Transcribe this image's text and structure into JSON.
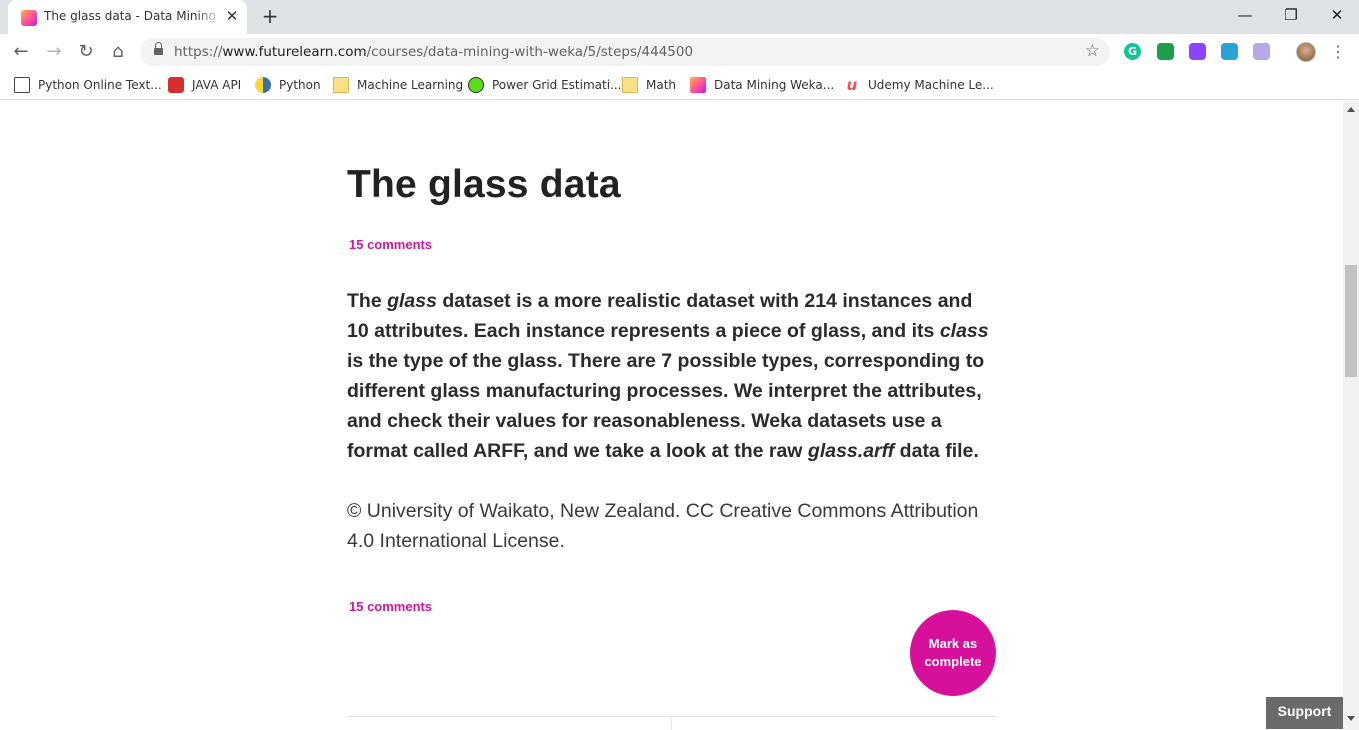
{
  "browser": {
    "tab": {
      "title": "The glass data - Data Mining with Weka",
      "close": "✕"
    },
    "new_tab": "+",
    "window": {
      "minimize": "—",
      "restore": "❐",
      "close": "✕"
    },
    "url": {
      "scheme": "https://",
      "host": "www.futurelearn.com",
      "path": "/courses/data-mining-with-weka/5/steps/444500"
    },
    "extensions": [
      "grammarly-icon",
      "cast-icon",
      "puzzle-icon",
      "cloud-icon",
      "puzzle-icon"
    ],
    "bookmarks": [
      {
        "label": "Python Online Text...",
        "icon": "page-icon"
      },
      {
        "label": "JAVA API",
        "icon": "java-icon"
      },
      {
        "label": "Python",
        "icon": "python-icon"
      },
      {
        "label": "Machine Learning",
        "icon": "folder-icon"
      },
      {
        "label": "Power Grid Estimati...",
        "icon": "smiley-icon"
      },
      {
        "label": "Math",
        "icon": "folder-icon"
      },
      {
        "label": "Data Mining Weka...",
        "icon": "futurelearn-icon"
      },
      {
        "label": "Udemy Machine Le...",
        "icon": "udemy-icon"
      }
    ]
  },
  "article": {
    "title": "The glass data",
    "comments_top": "15 comments",
    "summary": {
      "p1": "The ",
      "em1": "glass",
      "p2": " dataset is a more realistic dataset with 214 instances and 10 attributes. Each instance represents a piece of glass, and its ",
      "em2": "class",
      "p3": " is the type of the glass. There are 7 possible types, corresponding to different glass manufacturing processes. We interpret the attributes, and check their values for reasonableness. Weka datasets use a format called ARFF, and we take a look at the raw ",
      "em3": "glass.arff",
      "p4": " data file."
    },
    "copyright": "© University of Waikato, New Zealand. CC Creative Commons Attribution 4.0 International License.",
    "comments_bottom": "15 comments",
    "mark_complete": "Mark as complete"
  },
  "support_label": "Support",
  "colors": {
    "accent": "#d6109a",
    "heading": "#222222",
    "support_bg": "#6a6a6a"
  }
}
